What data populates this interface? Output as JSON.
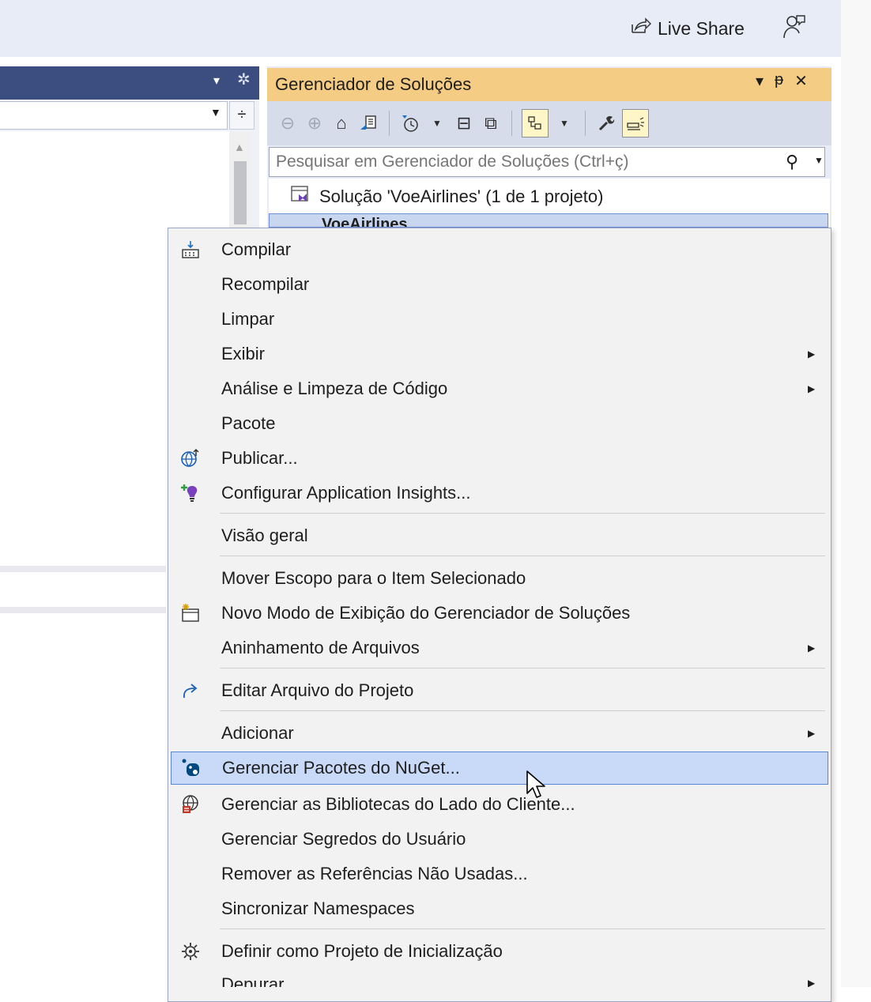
{
  "titlebar": {
    "live_share_label": "Live Share",
    "live_share_icon": "share-arrow-icon",
    "feedback_icon": "feedback-person-icon"
  },
  "left_pane": {
    "dropdown_arrow": "▾",
    "settings_glyph": "✲",
    "split_glyph": "÷"
  },
  "solution_explorer": {
    "title": "Gerenciador de Soluções",
    "pin_glyph": "ᵽ",
    "close_glyph": "✕",
    "menu_glyph": "▾",
    "toolbar": [
      "back-icon",
      "forward-icon",
      "home-icon",
      "switch-views-icon",
      "pending-changes-filter-icon",
      "collapse-all-icon",
      "show-all-files-icon",
      "sync-active-document-icon",
      "properties-icon",
      "preview-selected-items-icon"
    ],
    "search_placeholder": "Pesquisar em Gerenciador de Soluções (Ctrl+ç)",
    "solution_label": "Solução 'VoeAirlines' (1 de 1 projeto)",
    "project_label": "VoeAirlines"
  },
  "context_menu": {
    "items": [
      {
        "label": "Compilar",
        "icon": "build-icon"
      },
      {
        "label": "Recompilar"
      },
      {
        "label": "Limpar"
      },
      {
        "label": "Exibir",
        "submenu": true
      },
      {
        "label": "Análise e Limpeza de Código",
        "submenu": true
      },
      {
        "label": "Pacote"
      },
      {
        "label": "Publicar...",
        "icon": "publish-globe-icon"
      },
      {
        "label": "Configurar Application Insights...",
        "icon": "application-insights-icon"
      },
      {
        "label": "Visão geral"
      },
      {
        "label": "Mover Escopo para o Item Selecionado"
      },
      {
        "label": "Novo Modo de Exibição do Gerenciador de Soluções",
        "icon": "new-view-icon"
      },
      {
        "label": "Aninhamento de Arquivos",
        "submenu": true
      },
      {
        "label": "Editar Arquivo do Projeto",
        "icon": "edit-redo-arrow-icon"
      },
      {
        "label": "Adicionar",
        "submenu": true
      },
      {
        "label": "Gerenciar Pacotes do NuGet...",
        "icon": "nuget-icon",
        "highlighted": true
      },
      {
        "label": "Gerenciar as Bibliotecas do Lado do Cliente...",
        "icon": "client-libraries-icon"
      },
      {
        "label": "Gerenciar Segredos do Usuário"
      },
      {
        "label": "Remover as Referências Não Usadas..."
      },
      {
        "label": "Sincronizar Namespaces"
      },
      {
        "label": "Definir como Projeto de Inicialização",
        "icon": "startup-gear-icon"
      },
      {
        "label": "Depurar",
        "submenu": true
      }
    ]
  },
  "colors": {
    "accent_title": "#f5cc84",
    "menu_highlight": "#c9daf8",
    "dark_header": "#3c4e7f"
  }
}
